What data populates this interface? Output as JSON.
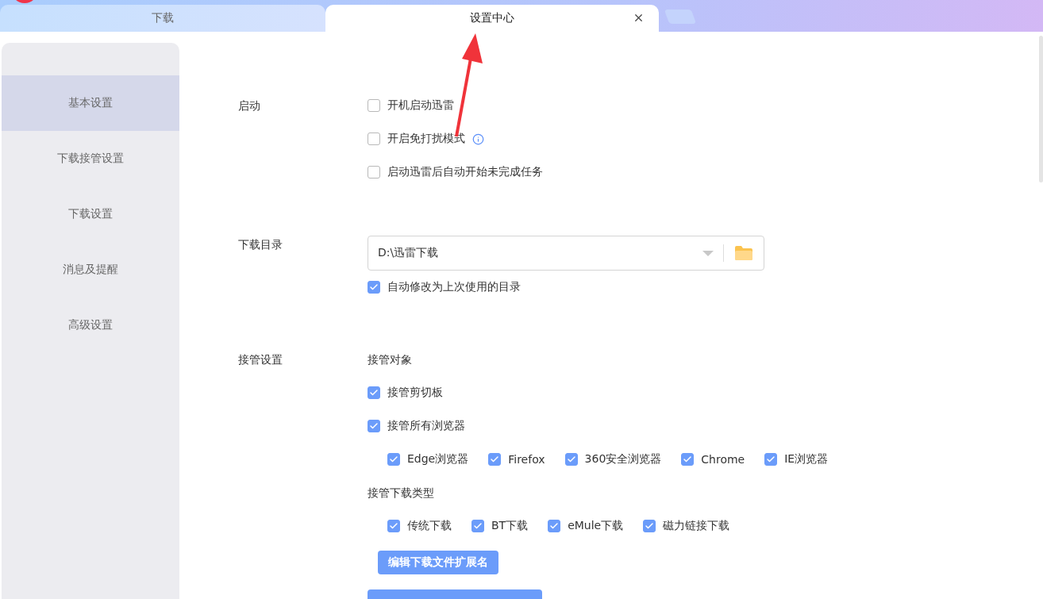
{
  "tabs": [
    {
      "label": "下载",
      "selected": false
    },
    {
      "label": "设置中心",
      "selected": true
    }
  ],
  "sidebar": {
    "items": [
      {
        "label": "基本设置",
        "selected": true
      },
      {
        "label": "下载接管设置",
        "selected": false
      },
      {
        "label": "下载设置",
        "selected": false
      },
      {
        "label": "消息及提醒",
        "selected": false
      },
      {
        "label": "高级设置",
        "selected": false
      }
    ]
  },
  "sections": [
    {
      "label": "启动",
      "items": [
        {
          "kind": "checkbox",
          "label": "开机启动迅雷",
          "checked": false
        },
        {
          "kind": "checkbox",
          "label": "开启免打扰模式",
          "checked": false,
          "info": true
        },
        {
          "kind": "checkbox",
          "label": "启动迅雷后自动开始未完成任务",
          "checked": false
        }
      ]
    },
    {
      "label": "下载目录",
      "items": [
        {
          "kind": "dropdown",
          "value": "D:\\迅雷下载"
        },
        {
          "kind": "checkbox",
          "label": "自动修改为上次使用的目录",
          "checked": true
        }
      ]
    },
    {
      "label": "接管设置",
      "items": [
        {
          "kind": "heading",
          "label": "接管对象"
        },
        {
          "kind": "checkbox",
          "label": "接管剪切板",
          "checked": true
        },
        {
          "kind": "checkbox",
          "label": "接管所有浏览器",
          "checked": true
        },
        {
          "kind": "group",
          "items": [
            {
              "label": "Edge浏览器",
              "checked": true
            },
            {
              "label": "Firefox",
              "checked": true
            },
            {
              "label": "360安全浏览器",
              "checked": true
            },
            {
              "label": "Chrome",
              "checked": true
            },
            {
              "label": "IE浏览器",
              "checked": true
            }
          ]
        },
        {
          "kind": "heading",
          "label": "接管下载类型"
        },
        {
          "kind": "group",
          "items": [
            {
              "label": "传统下载",
              "checked": true
            },
            {
              "label": "BT下载",
              "checked": true
            },
            {
              "label": "eMule下载",
              "checked": true
            },
            {
              "label": "磁力链接下载",
              "checked": true
            }
          ]
        },
        {
          "kind": "button",
          "label": "编辑下载文件扩展名"
        },
        {
          "kind": "wide_button"
        }
      ]
    }
  ]
}
